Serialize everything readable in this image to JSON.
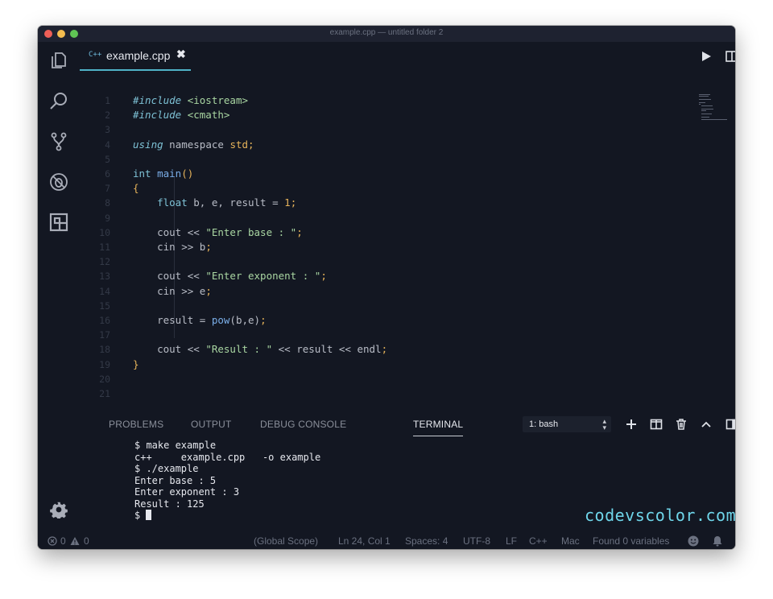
{
  "window": {
    "title": "example.cpp — untitled folder 2"
  },
  "activity_bar": {
    "icons": [
      "files-icon",
      "search-icon",
      "source-control-icon",
      "debug-icon",
      "extensions-icon",
      "settings-gear-icon"
    ]
  },
  "editor": {
    "tab": {
      "lang_badge": "C++",
      "label": "example.cpp",
      "close": "✖"
    },
    "lines": [
      {
        "n": "1",
        "segs": [
          [
            "c-meta",
            "#include "
          ],
          [
            "c-str",
            "<iostream>"
          ]
        ]
      },
      {
        "n": "2",
        "segs": [
          [
            "c-meta",
            "#include "
          ],
          [
            "c-str",
            "<cmath>"
          ]
        ]
      },
      {
        "n": "3",
        "segs": []
      },
      {
        "n": "4",
        "segs": [
          [
            "c-kw",
            "using"
          ],
          [
            "c-id",
            " namespace "
          ],
          [
            "c-num",
            "std"
          ],
          [
            "c-punc",
            ";"
          ]
        ]
      },
      {
        "n": "5",
        "segs": []
      },
      {
        "n": "6",
        "segs": [
          [
            "c-type",
            "int "
          ],
          [
            "c-fn",
            "main"
          ],
          [
            "c-punc",
            "()"
          ]
        ]
      },
      {
        "n": "7",
        "segs": [
          [
            "c-punc",
            "{"
          ]
        ]
      },
      {
        "n": "8",
        "segs": [
          [
            "c-id",
            "    "
          ],
          [
            "c-type",
            "float "
          ],
          [
            "c-id",
            "b, e, result = "
          ],
          [
            "c-num",
            "1"
          ],
          [
            "c-punc",
            ";"
          ]
        ]
      },
      {
        "n": "9",
        "segs": []
      },
      {
        "n": "10",
        "segs": [
          [
            "c-id",
            "    cout << "
          ],
          [
            "c-str",
            "\"Enter base : \""
          ],
          [
            "c-punc",
            ";"
          ]
        ]
      },
      {
        "n": "11",
        "segs": [
          [
            "c-id",
            "    cin >> b"
          ],
          [
            "c-punc",
            ";"
          ]
        ]
      },
      {
        "n": "12",
        "segs": []
      },
      {
        "n": "13",
        "segs": [
          [
            "c-id",
            "    cout << "
          ],
          [
            "c-str",
            "\"Enter exponent : \""
          ],
          [
            "c-punc",
            ";"
          ]
        ]
      },
      {
        "n": "14",
        "segs": [
          [
            "c-id",
            "    cin >> e"
          ],
          [
            "c-punc",
            ";"
          ]
        ]
      },
      {
        "n": "15",
        "segs": []
      },
      {
        "n": "16",
        "segs": [
          [
            "c-id",
            "    result = "
          ],
          [
            "c-fn",
            "pow"
          ],
          [
            "c-id",
            "(b,e)"
          ],
          [
            "c-punc",
            ";"
          ]
        ]
      },
      {
        "n": "17",
        "segs": []
      },
      {
        "n": "18",
        "segs": [
          [
            "c-id",
            "    cout << "
          ],
          [
            "c-str",
            "\"Result : \""
          ],
          [
            "c-id",
            " << result << endl"
          ],
          [
            "c-punc",
            ";"
          ]
        ]
      },
      {
        "n": "19",
        "segs": [
          [
            "c-punc",
            "}"
          ]
        ]
      },
      {
        "n": "20",
        "segs": []
      },
      {
        "n": "21",
        "segs": []
      }
    ]
  },
  "panel": {
    "tabs": [
      "PROBLEMS",
      "OUTPUT",
      "DEBUG CONSOLE",
      "TERMINAL"
    ],
    "active_tab": "TERMINAL",
    "terminal_select": "1: bash",
    "terminal_lines": [
      "$ make example",
      "c++     example.cpp   -o example",
      "$ ./example",
      "Enter base : 5",
      "Enter exponent : 3",
      "Result : 125"
    ],
    "prompt": "$ ",
    "watermark": "codevscolor.com"
  },
  "status_bar": {
    "errors": "0",
    "warnings": "0",
    "scope": "(Global Scope)",
    "position": "Ln 24, Col 1",
    "spaces": "Spaces: 4",
    "encoding": "UTF-8",
    "eol": "LF",
    "language": "C++",
    "platform": "Mac",
    "variables": "Found 0 variables"
  }
}
